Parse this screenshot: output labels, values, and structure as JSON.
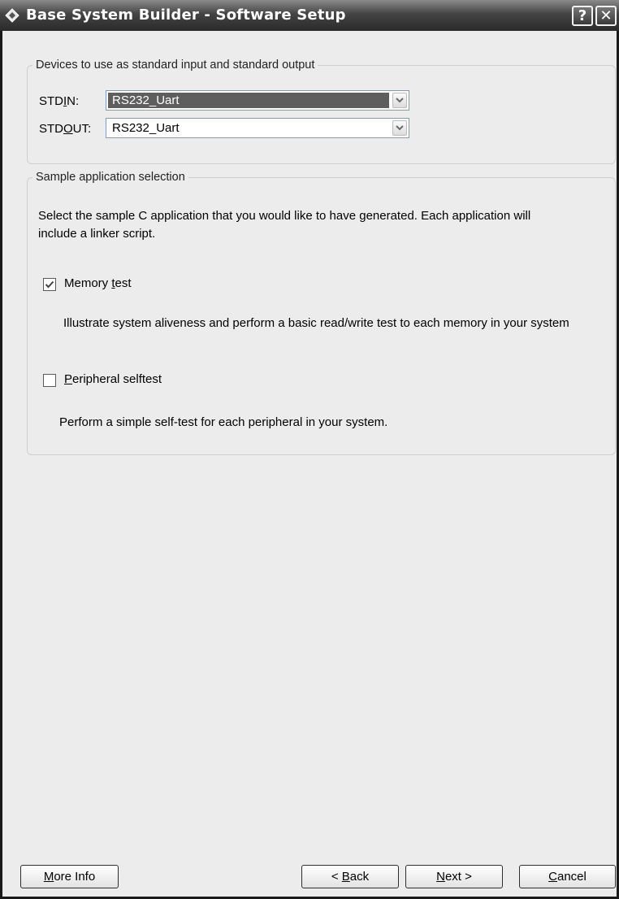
{
  "window": {
    "title": "Base System Builder - Software Setup",
    "help_label": "?",
    "close_label": "✕"
  },
  "io_group": {
    "legend": "Devices to use as standard input and standard output",
    "stdin": {
      "label_prefix": "STD",
      "label_mnemonic": "I",
      "label_suffix": "N:",
      "value": "RS232_Uart"
    },
    "stdout": {
      "label_prefix": "STD",
      "label_mnemonic": "O",
      "label_suffix": "UT:",
      "value": "RS232_Uart"
    }
  },
  "app_group": {
    "legend": "Sample application selection",
    "intro_line1": "Select the sample C application that you would like to have generated.  Each application will",
    "intro_line2": "include a linker script.",
    "options": [
      {
        "checked": true,
        "label_before": "Memory ",
        "label_mnemonic": "t",
        "label_after": "est",
        "description": "Illustrate system aliveness and perform a basic read/write test to each memory in your system"
      },
      {
        "checked": false,
        "label_before": "",
        "label_mnemonic": "P",
        "label_after": "eripheral selftest",
        "description": "Perform a simple self-test for each peripheral in your system."
      }
    ]
  },
  "buttons": {
    "more_info": {
      "mnemonic": "M",
      "rest": "ore Info"
    },
    "back": {
      "before": "< ",
      "mnemonic": "B",
      "rest": "ack"
    },
    "next": {
      "mnemonic": "N",
      "rest": "ext >"
    },
    "cancel": {
      "mnemonic": "C",
      "rest": "ancel"
    }
  }
}
